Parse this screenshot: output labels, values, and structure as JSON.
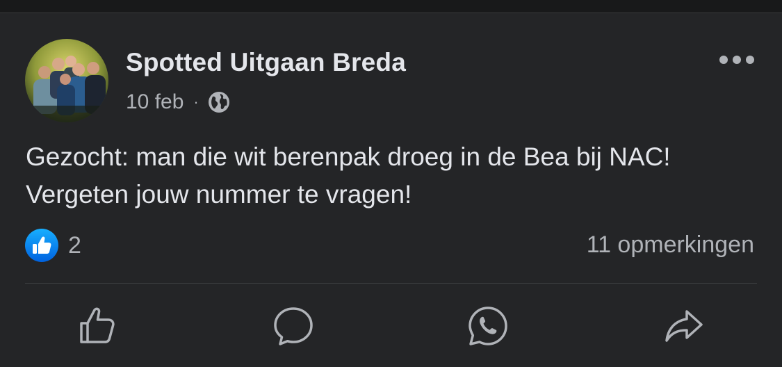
{
  "post": {
    "page_name": "Spotted Uitgaan Breda",
    "date": "10 feb",
    "separator": "·",
    "privacy_icon": "globe-icon",
    "text": "Gezocht: man die wit berenpak droeg in de Bea bij NAC! Vergeten jouw nummer te vragen!"
  },
  "stats": {
    "like_count": "2",
    "comments": "11 opmerkingen"
  },
  "actions": [
    {
      "name": "like",
      "icon": "thumbs-up-icon"
    },
    {
      "name": "comment",
      "icon": "comment-bubble-icon"
    },
    {
      "name": "whatsapp",
      "icon": "whatsapp-icon"
    },
    {
      "name": "share",
      "icon": "share-arrow-icon"
    }
  ],
  "colors": {
    "background": "#242527",
    "primary_text": "#e4e6eb",
    "secondary_text": "#b0b3b8",
    "like_blue": "#1877f2"
  }
}
